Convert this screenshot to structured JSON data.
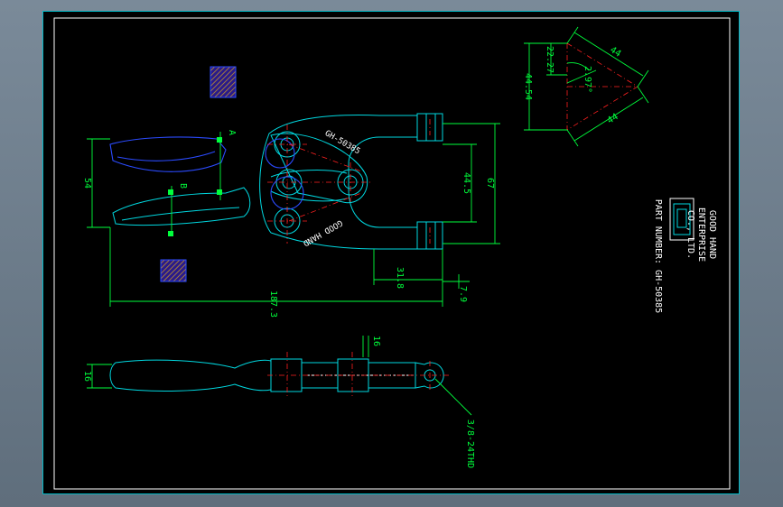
{
  "drawing": {
    "dimensions": {
      "d_22_27": "22.27",
      "d_44_54": "44.54",
      "d_2_97": "2.97°",
      "d_44_top": "44",
      "d_44_bottom": "44",
      "d_54": "54",
      "d_44_5": "44.5",
      "d_67": "67",
      "d_31_8": "31.8",
      "d_7_9": "7.9",
      "d_187_3": "187.3",
      "d_16_top": "16",
      "d_16_left": "16",
      "d_thread": "3/8-24THD"
    },
    "section_labels": {
      "a": "A",
      "b": "B"
    },
    "part_markings": {
      "part_no_on_body": "GH-50385",
      "brand_on_body": "GOOD HAND"
    },
    "title_block": {
      "company_line1": "GOOD HAND",
      "company_line2": "ENTERPRISE",
      "company_line3": "CO., LTD.",
      "part_number": "PART NUMBER: GH-50385"
    },
    "colors": {
      "background": "#000000",
      "outline": "#00d8e0",
      "dimension": "#00ff3c",
      "centerline": "#ff2020",
      "hidden": "#2b4bff",
      "hatch": "#7a2fd0"
    }
  }
}
